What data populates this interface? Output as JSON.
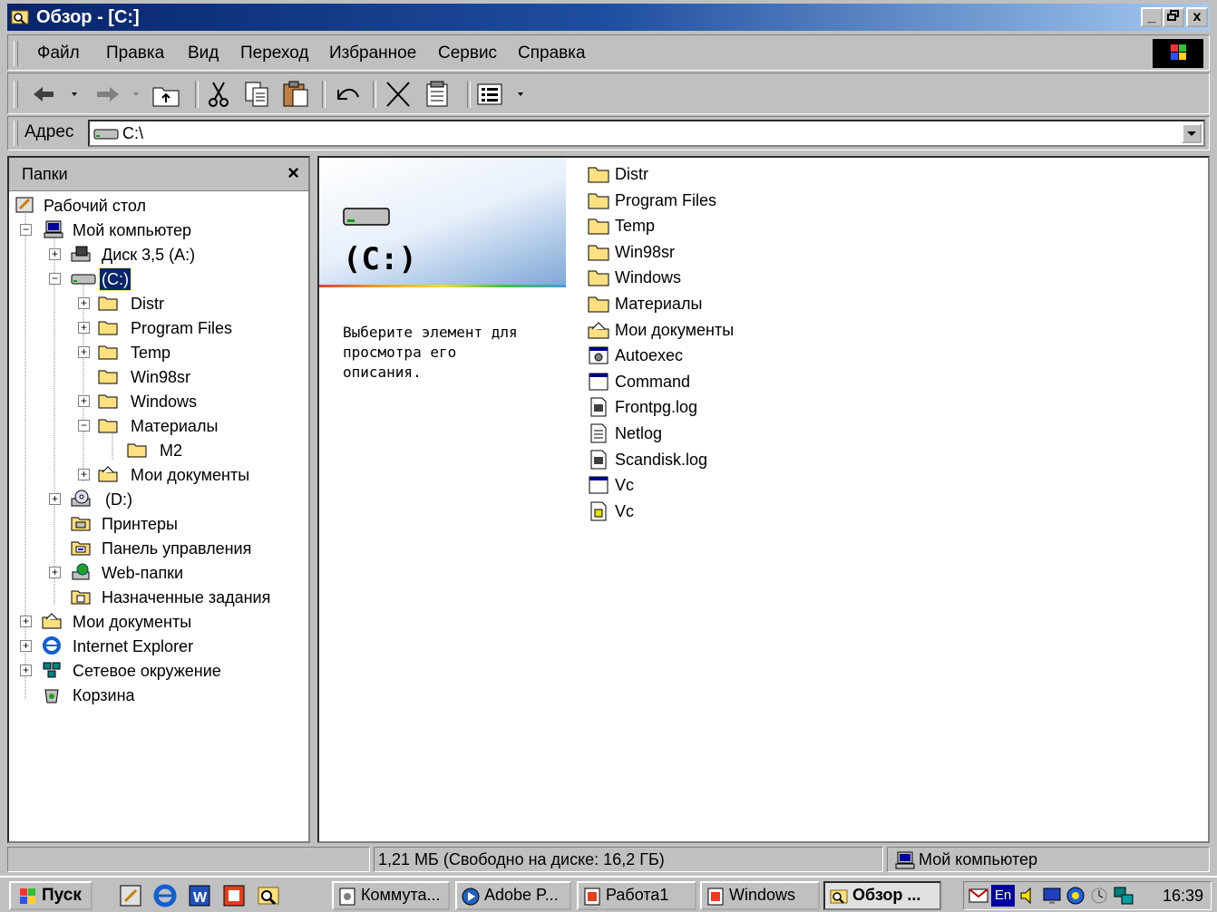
{
  "window": {
    "title": "Обзор - [C:]",
    "min": "_",
    "max": "▫",
    "close": "x"
  },
  "menu": [
    {
      "label": "Файл"
    },
    {
      "label": "Правка"
    },
    {
      "label": "Вид"
    },
    {
      "label": "Переход"
    },
    {
      "label": "Избранное"
    },
    {
      "label": "Сервис"
    },
    {
      "label": "Справка"
    }
  ],
  "address": {
    "label": "Адрес",
    "value": "C:\\"
  },
  "folders": {
    "title": "Папки",
    "close": "×",
    "tree": [
      {
        "label": "Рабочий стол"
      },
      {
        "label": "Мой компьютер"
      },
      {
        "label": "Диск 3,5 (A:)"
      },
      {
        "label": "(C:)"
      },
      {
        "label": "Distr"
      },
      {
        "label": "Program Files"
      },
      {
        "label": "Temp"
      },
      {
        "label": "Win98sr"
      },
      {
        "label": "Windows"
      },
      {
        "label": "Материалы"
      },
      {
        "label": "M2"
      },
      {
        "label": "Мои документы"
      },
      {
        "label": "(D:)"
      },
      {
        "label": "Принтеры"
      },
      {
        "label": "Панель управления"
      },
      {
        "label": "Web-папки"
      },
      {
        "label": "Назначенные задания"
      },
      {
        "label": "Мои документы"
      },
      {
        "label": "Internet Explorer"
      },
      {
        "label": "Сетевое окружение"
      },
      {
        "label": "Корзина"
      }
    ]
  },
  "content": {
    "title": "(C:)",
    "description": "Выберите элемент для просмотра его описания.",
    "files": [
      {
        "name": "Distr",
        "icon": "folder-icon"
      },
      {
        "name": "Program Files",
        "icon": "folder-icon"
      },
      {
        "name": "Temp",
        "icon": "folder-icon"
      },
      {
        "name": "Win98sr",
        "icon": "folder-icon"
      },
      {
        "name": "Windows",
        "icon": "folder-icon"
      },
      {
        "name": "Материалы",
        "icon": "folder-icon"
      },
      {
        "name": "Мои документы",
        "icon": "my-documents-icon"
      },
      {
        "name": "Autoexec",
        "icon": "batch-file-icon"
      },
      {
        "name": "Command",
        "icon": "dos-program-icon"
      },
      {
        "name": "Frontpg.log",
        "icon": "log-file-icon"
      },
      {
        "name": "Netlog",
        "icon": "text-file-icon"
      },
      {
        "name": "Scandisk.log",
        "icon": "log-file-icon"
      },
      {
        "name": "Vc",
        "icon": "dos-program-icon"
      },
      {
        "name": "Vc",
        "icon": "config-file-icon"
      }
    ]
  },
  "status": {
    "size": "1,21 МБ (Свободно на диске: 16,2 ГБ)",
    "zone": "Мой компьютер"
  },
  "taskbar": {
    "start": "Пуск",
    "tasks": [
      {
        "label": "Коммута..."
      },
      {
        "label": "Adobe P..."
      },
      {
        "label": "Работа1"
      },
      {
        "label": "Windows"
      },
      {
        "label": "Обзор ..."
      }
    ],
    "tray_lang": "En",
    "clock": "16:39"
  }
}
